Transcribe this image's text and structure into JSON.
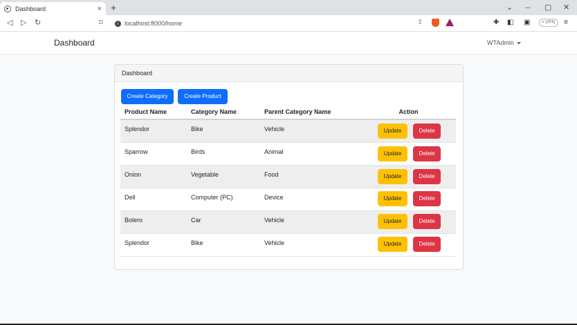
{
  "browser": {
    "tab_title": "Dashboard",
    "tab_close": "×",
    "new_tab": "+",
    "url": "localhost:8000/home",
    "vpn": "• VPN"
  },
  "navbar": {
    "brand": "Dashboard",
    "user": "WTAdmin"
  },
  "card": {
    "header": "Dashboard",
    "create_category": "Create Category",
    "create_product": "Create Product"
  },
  "table": {
    "headers": [
      "Product Name",
      "Category Name",
      "Parent Category Name",
      "Action"
    ],
    "rows": [
      {
        "product": "Splendor",
        "category": "Bike",
        "parent": "Vehicle"
      },
      {
        "product": "Sparrow",
        "category": "Birds",
        "parent": "Animal"
      },
      {
        "product": "Onion",
        "category": "Vegetable",
        "parent": "Food"
      },
      {
        "product": "Dell",
        "category": "Computer (PC)",
        "parent": "Device"
      },
      {
        "product": "Bolero",
        "category": "Car",
        "parent": "Vehicle"
      },
      {
        "product": "Splendor",
        "category": "Bike",
        "parent": "Vehicle"
      }
    ],
    "update_label": "Update",
    "delete_label": "Delete"
  },
  "colors": {
    "primary": "#0d6efd",
    "warning": "#ffc107",
    "danger": "#dc3545"
  }
}
